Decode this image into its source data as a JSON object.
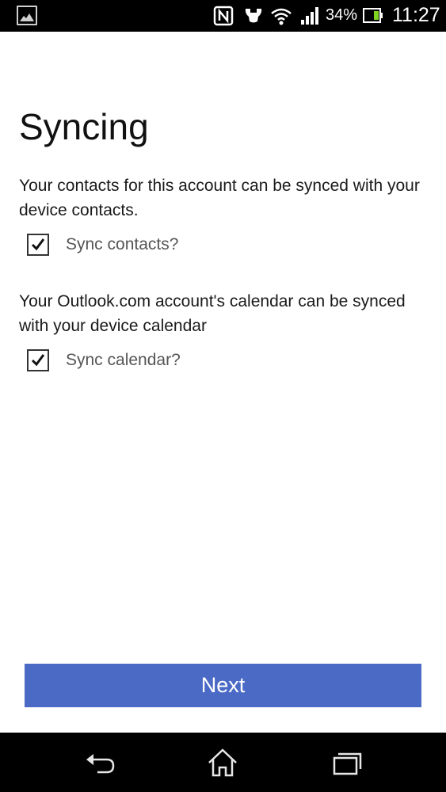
{
  "status_bar": {
    "battery_percent": "34%",
    "time": "11:27",
    "icons": [
      "gallery-notification-icon",
      "nfc-icon",
      "handset-icon",
      "wifi-icon",
      "signal-icon",
      "battery-icon"
    ]
  },
  "page": {
    "title": "Syncing",
    "contacts_description": "Your contacts for this account can be synced with your device contacts.",
    "contacts_checkbox_label": "Sync contacts?",
    "contacts_checked": true,
    "calendar_description": "Your Outlook.com account's calendar can be synced with your device calendar",
    "calendar_checkbox_label": "Sync calendar?",
    "calendar_checked": true
  },
  "actions": {
    "next_label": "Next"
  },
  "colors": {
    "accent": "#4a6ac6",
    "status_bar_bg": "#000000",
    "nav_bar_bg": "#000000"
  },
  "nav_bar": {
    "buttons": [
      "back-icon",
      "home-icon",
      "recent-apps-icon"
    ]
  }
}
